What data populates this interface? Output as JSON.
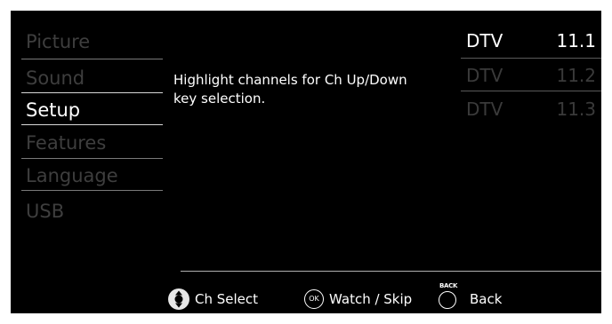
{
  "menu": {
    "items": [
      {
        "label": "Picture",
        "active": false
      },
      {
        "label": "Sound",
        "active": false
      },
      {
        "label": "Setup",
        "active": true
      },
      {
        "label": "Features",
        "active": false
      },
      {
        "label": "Language",
        "active": false
      },
      {
        "label": "USB",
        "active": false
      }
    ]
  },
  "description": {
    "line1": "Highlight channels for Ch Up/Down",
    "line2": "key selection."
  },
  "channels": [
    {
      "type": "DTV",
      "number": "11.1",
      "highlighted": true
    },
    {
      "type": "DTV",
      "number": "11.2",
      "highlighted": false
    },
    {
      "type": "DTV",
      "number": "11.3",
      "highlighted": false
    }
  ],
  "hints": {
    "select_label": "Ch Select",
    "watch_label": "Watch / Skip",
    "back_label": "Back",
    "ok_glyph": "OK",
    "back_glyph": "BACK"
  },
  "colors": {
    "background": "#000000",
    "active_text": "#ffffff",
    "inactive_text": "#3e3e3e"
  }
}
